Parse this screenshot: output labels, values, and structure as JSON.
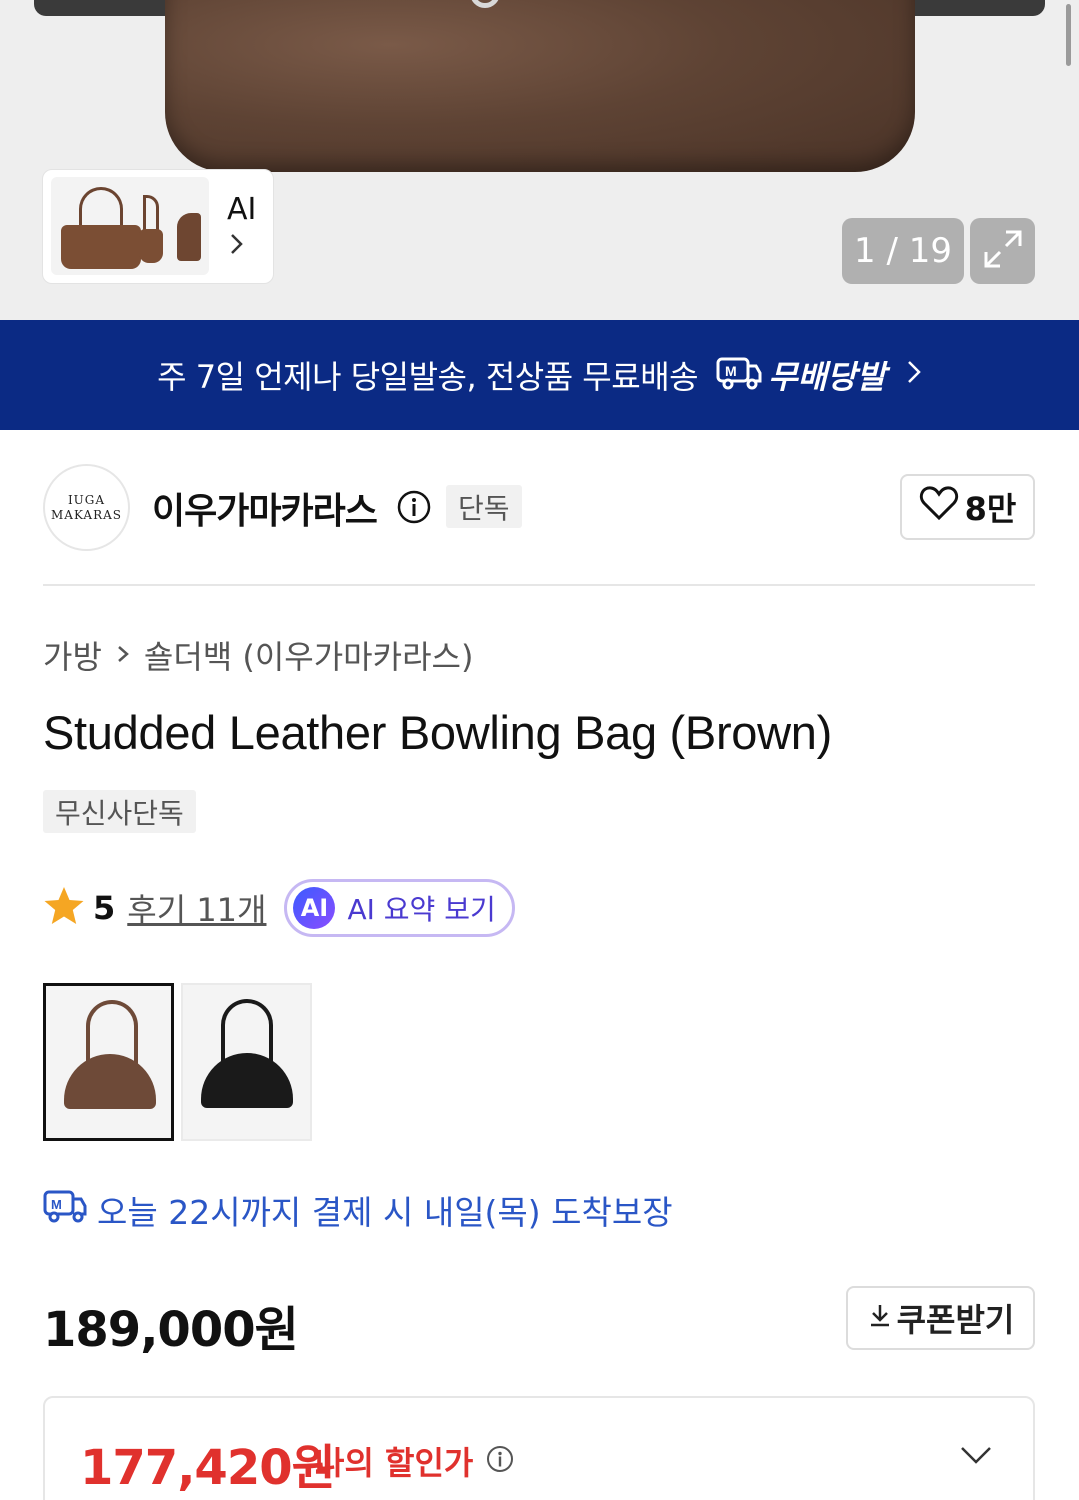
{
  "gallery": {
    "ai_label": "AI",
    "counter": "1 / 19"
  },
  "banner": {
    "text": "주 7일 언제나 당일발송, 전상품 무료배송",
    "logo_text": "무배당발",
    "logo_icon": "m-truck-icon"
  },
  "brand": {
    "logo_line1": "IUGA",
    "logo_line2": "MAKARAS",
    "name": "이우가마카라스",
    "badge": "단독",
    "likes": "8만"
  },
  "breadcrumb": {
    "category": "가방",
    "subcategory": "숄더백 (이우가마카라스)"
  },
  "product": {
    "title": "Studded Leather Bowling Bag (Brown)",
    "exclusive_badge": "무신사단독",
    "rating": "5",
    "review_link": "후기 11개",
    "ai_badge": "AI",
    "ai_summary": "AI 요약 보기",
    "color_options": [
      {
        "name": "brown",
        "color": "#6e4a38"
      },
      {
        "name": "black",
        "color": "#1a1a1a"
      }
    ],
    "delivery": "오늘 22시까지 결제 시 내일(목) 도착보장",
    "price": "189,000원",
    "coupon_label": "쿠폰받기",
    "discount_price": "177,420원",
    "discount_label": "나의 할인가"
  },
  "colors": {
    "banner_bg": "#0b2a84",
    "delivery_blue": "#2a56c6",
    "discount_red": "#e0312d",
    "star": "#f5a623"
  }
}
